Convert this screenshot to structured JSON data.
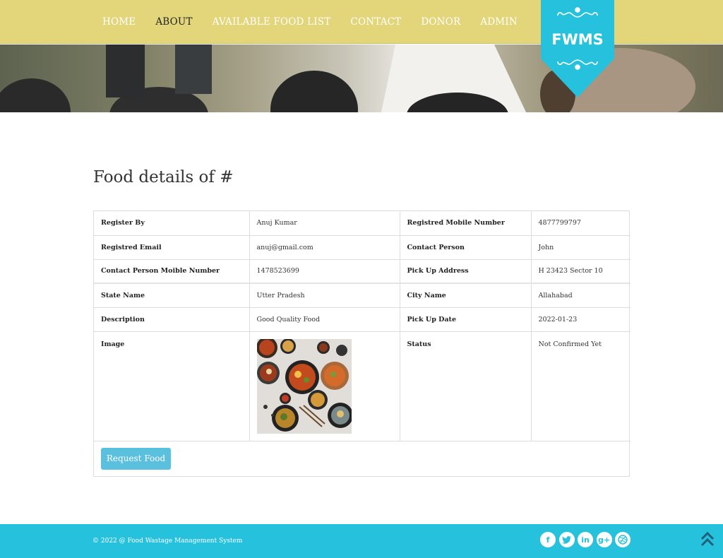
{
  "nav": {
    "items": [
      {
        "label": "HOME",
        "active": false
      },
      {
        "label": "ABOUT",
        "active": true
      },
      {
        "label": "AVAILABLE FOOD LIST",
        "active": false
      },
      {
        "label": "CONTACT",
        "active": false
      },
      {
        "label": "DONOR",
        "active": false
      },
      {
        "label": "ADMIN",
        "active": false
      }
    ]
  },
  "logo": {
    "text": "FWMS",
    "color": "#26c1dc"
  },
  "page": {
    "title": "Food details of #"
  },
  "details": {
    "rows": [
      {
        "label1": "Register By",
        "value1": "Anuj Kumar",
        "label2": "Registred Mobile Number",
        "value2": "4877799797"
      },
      {
        "label1": "Registred Email",
        "value1": "anuj@gmail.com",
        "label2": "Contact Person",
        "value2": "John"
      },
      {
        "label1": "Contact Person Moible Number",
        "value1": "1478523699",
        "label2": "Pick Up Address",
        "value2": "H 23423 Sector 10"
      },
      {
        "label1": "State Name",
        "value1": "Utter Pradesh",
        "label2": "City Name",
        "value2": "Allahabad"
      },
      {
        "label1": "Description",
        "value1": "Good Quality Food",
        "label2": "Pick Up Date",
        "value2": "2022-01-23"
      },
      {
        "label1": "Image",
        "value1": "",
        "label2": "Status",
        "value2": "Not Confirmed Yet"
      }
    ],
    "request_button": "Request Food"
  },
  "footer": {
    "copyright": "© 2022 @ Food Wastage Management System",
    "social": [
      "facebook-icon",
      "twitter-icon",
      "linkedin-icon",
      "google-plus-icon",
      "dribbble-icon"
    ],
    "back_to_top": "double-chevron-up-icon",
    "color": "#26c1dc"
  },
  "colors": {
    "navbar": "#e2d57a",
    "accent": "#5bc0de"
  }
}
